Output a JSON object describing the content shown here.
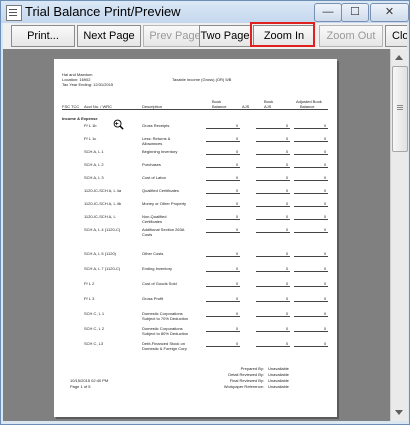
{
  "window": {
    "title": "Trial Balance Print/Preview"
  },
  "window_buttons": {
    "minimize": "—",
    "maximize": "☐",
    "close": "✕"
  },
  "toolbar": {
    "print": "Print...",
    "next_page": "Next Page",
    "prev_page": "Prev Page",
    "two_page": "Two Page",
    "zoom_in": "Zoom In",
    "zoom_out": "Zoom Out",
    "close": "Clo"
  },
  "report": {
    "client_name": "Hal and Maedum",
    "client_location": "Location: 16902",
    "tax_year": "Tax Year Ending: 12/31/2015",
    "form_title": "Taxable Income (Gross) (OR) 5/B",
    "col_headers": {
      "fsc": "FSC TCC",
      "account": "Acct No. / WRC",
      "description": "Description",
      "book_balance_1": "Book",
      "book_balance_2": "Balance",
      "ajs": "AJS",
      "book_ajs_1": "Book",
      "book_ajs_2": "AJS",
      "adjusted_1": "Adjusted Book",
      "adjusted_2": "Balance"
    },
    "section": "Income & Expense",
    "rows": [
      {
        "code": "P/ L 1b",
        "desc": "Gross Receipts",
        "desc2": "",
        "v1": "0",
        "v2": "0",
        "v3": "0"
      },
      {
        "code": "P/ L 1c",
        "desc": "Less: Returns &",
        "desc2": "Allowances",
        "v1": "0",
        "v2": "0",
        "v3": "0"
      },
      {
        "code": "SCH A, L 1",
        "desc": "Beginning Inventory",
        "desc2": "",
        "v1": "0",
        "v2": "0",
        "v3": "0"
      },
      {
        "code": "SCH A, L 2",
        "desc": "Purchases",
        "desc2": "",
        "v1": "0",
        "v2": "0",
        "v3": "0"
      },
      {
        "code": "SCH A, L 3",
        "desc": "Cost of Labor",
        "desc2": "",
        "v1": "0",
        "v2": "0",
        "v3": "0"
      },
      {
        "code": "1120-IC-SCH A, L 4a",
        "desc": "Qualified Certificates",
        "desc2": "",
        "v1": "0",
        "v2": "0",
        "v3": "0"
      },
      {
        "code": "1120-IC-SCH A, L 4b",
        "desc": "Money or Other Property",
        "desc2": "",
        "v1": "0",
        "v2": "0",
        "v3": "0"
      },
      {
        "code": "1120-IC-SCH A, L",
        "desc": "Non-Qualified",
        "desc2": "Certificates",
        "v1": "0",
        "v2": "0",
        "v3": "0"
      },
      {
        "code": "SCH A, L 4 (1120-C)",
        "desc": "Additional Section 263A",
        "desc2": "Costs",
        "v1": "0",
        "v2": "0",
        "v3": "0"
      }
    ],
    "rows2": [
      {
        "code": "SCH A, L 5 (1120)",
        "desc": "Other Costs",
        "desc2": "",
        "v1": "0",
        "v2": "0",
        "v3": "0"
      },
      {
        "code": "SCH A, L 7 (1120-C)",
        "desc": "Ending Inventory",
        "desc2": "",
        "v1": "0",
        "v2": "0",
        "v3": "0"
      },
      {
        "code": "P/ L 2",
        "desc": "Cost of Goods Sold",
        "desc2": "",
        "v1": "0",
        "v2": "0",
        "v3": "0"
      },
      {
        "code": "P/ L 3",
        "desc": "Gross Profit",
        "desc2": "",
        "v1": "0",
        "v2": "0",
        "v3": "0"
      },
      {
        "code": "SCH C, L 1",
        "desc": "Domestic Corporations",
        "desc2": "Subject to 70% Deduction",
        "v1": "0",
        "v2": "0",
        "v3": "0"
      },
      {
        "code": "SCH C, L 2",
        "desc": "Domestic Corporations",
        "desc2": "Subject to 80% Deduction",
        "v1": "0",
        "v2": "0",
        "v3": "0"
      },
      {
        "code": "SCH C, L3",
        "desc": "Debt-Financed Stock on",
        "desc2": "Domestic & Foreign Corp",
        "v1": "0",
        "v2": "0",
        "v3": "0"
      }
    ],
    "footer": {
      "prepared_by_label": "Prepared By:",
      "prepared_by_value": "Unavailable",
      "detail_reviewed_label": "Detail Reviewed By:",
      "detail_reviewed_value": "Unavailable",
      "final_reviewed_label": "Final Reviewed By:",
      "final_reviewed_value": "Unavailable",
      "workpaper_label": "Workpaper Reference:",
      "workpaper_value": "Unavailable",
      "timestamp": "10/15/2015   02:40 PM",
      "page": "Page 1 of 5"
    }
  }
}
